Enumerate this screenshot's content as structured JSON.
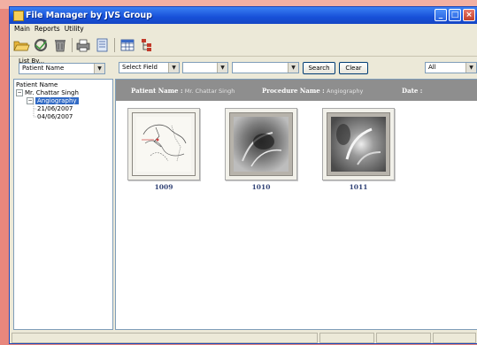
{
  "window": {
    "title": "File Manager by JVS Group",
    "min_glyph": "_",
    "max_glyph": "□",
    "close_glyph": "×"
  },
  "menu": [
    "Main",
    "Reports",
    "Utility"
  ],
  "toolbar_icons": [
    "open-folder-icon",
    "refresh-icon",
    "delete-icon",
    "print-icon",
    "document-icon",
    "grid-view-icon",
    "tree-view-icon"
  ],
  "list_by": {
    "label": "List By...",
    "value": "Patient Name"
  },
  "tree": {
    "root": "Patient Name",
    "patient": "Mr. Chattar Singh",
    "procedure": "Angiography",
    "dates": [
      "21/06/2007",
      "04/06/2007"
    ]
  },
  "filters": {
    "field_select": "Select Field",
    "search_label": "Search",
    "clear_label": "Clear",
    "scope": "All"
  },
  "header": {
    "patient_label": "Patient Name :",
    "patient_value": "Mr. Chattar Singh",
    "procedure_label": "Procedure Name :",
    "procedure_value": "Angiography",
    "date_label": "Date :"
  },
  "thumbnails": [
    {
      "id": "1009",
      "kind": "sketch"
    },
    {
      "id": "1010",
      "kind": "xray"
    },
    {
      "id": "1011",
      "kind": "xray"
    }
  ],
  "colors": {
    "selection": "#316ac5",
    "header_bar": "#8e8e8e",
    "titlebar": "#1750d8",
    "thumb_label": "#334477"
  }
}
